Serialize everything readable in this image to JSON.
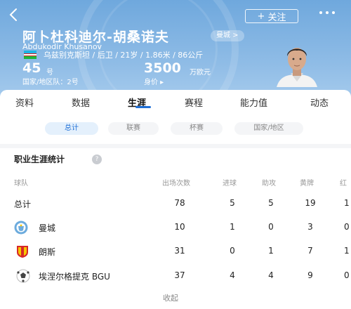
{
  "header": {
    "back_icon": "back-chevron-icon",
    "follow_label": "关注",
    "follow_icon_glyph": "+",
    "more_icon": "more-dots-icon"
  },
  "player": {
    "name": "阿卜杜科迪尔-胡桑诺夫",
    "name_latin": "Abdukodir Khusanov",
    "club": "曼城 >",
    "nationality_flag": "uzbekistan-flag-icon",
    "details": "乌兹别克斯坦 / 后卫 / 21岁 / 1.86米 / 86公斤",
    "number": "45",
    "number_unit": "号",
    "national_team_number": "国家/地区队：2号",
    "market_value": "3500",
    "market_value_unit": "万欧元",
    "market_value_label": "身价 ▸"
  },
  "tabs": [
    {
      "label": "资料"
    },
    {
      "label": "数据"
    },
    {
      "label": "生涯"
    },
    {
      "label": "赛程"
    },
    {
      "label": "能力值"
    },
    {
      "label": "动态"
    }
  ],
  "active_tab": "生涯",
  "filters": [
    {
      "label": "总计"
    },
    {
      "label": "联赛"
    },
    {
      "label": "杯赛"
    },
    {
      "label": "国家/地区"
    }
  ],
  "active_filter": "总计",
  "section": {
    "title": "职业生涯统计"
  },
  "table": {
    "headers": [
      "球队",
      "出场次数",
      "进球",
      "助攻",
      "黄牌",
      "红"
    ],
    "rows": [
      {
        "team": "总计",
        "logo": "",
        "apps": "78",
        "goals": "5",
        "assists": "5",
        "yellow": "19",
        "red": "1"
      },
      {
        "team": "曼城",
        "logo": "man-city-logo-icon",
        "apps": "10",
        "goals": "1",
        "assists": "0",
        "yellow": "3",
        "red": "0"
      },
      {
        "team": "朗斯",
        "logo": "rc-lens-logo-icon",
        "apps": "31",
        "goals": "0",
        "assists": "1",
        "yellow": "7",
        "red": "1"
      },
      {
        "team": "埃涅尔格提克 BGU",
        "logo": "energetik-bgu-logo-icon",
        "apps": "37",
        "goals": "4",
        "assists": "4",
        "yellow": "9",
        "red": "0"
      }
    ],
    "collapse_label": "收起"
  },
  "colors": {
    "hero_blue": "#7ab2e2",
    "accent": "#1f6fd6",
    "muted": "#999999"
  }
}
